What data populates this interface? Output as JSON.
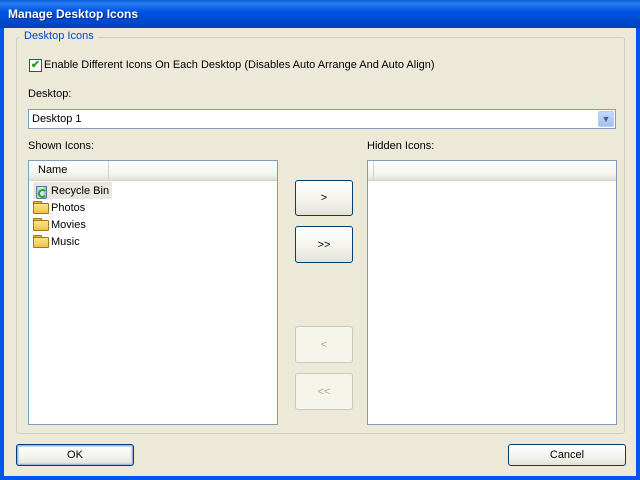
{
  "window": {
    "title": "Manage Desktop Icons"
  },
  "group": {
    "legend": "Desktop Icons"
  },
  "enable_checkbox": {
    "checked": true,
    "label": "Enable Different Icons On Each Desktop (Disables Auto Arrange And Auto Align)"
  },
  "desktop": {
    "label": "Desktop:",
    "selected": "Desktop 1"
  },
  "shown": {
    "label": "Shown Icons:",
    "column": "Name",
    "items": [
      {
        "name": "Recycle Bin",
        "icon": "recycle-bin-icon",
        "selected": true
      },
      {
        "name": "Photos",
        "icon": "folder-icon"
      },
      {
        "name": "Movies",
        "icon": "folder-icon"
      },
      {
        "name": "Music",
        "icon": "folder-icon"
      }
    ]
  },
  "hidden": {
    "label": "Hidden Icons:",
    "items": []
  },
  "buttons": {
    "move_right": ">",
    "move_all_right": ">>",
    "move_left": "<",
    "move_all_left": "<<",
    "ok": "OK",
    "cancel": "Cancel"
  }
}
